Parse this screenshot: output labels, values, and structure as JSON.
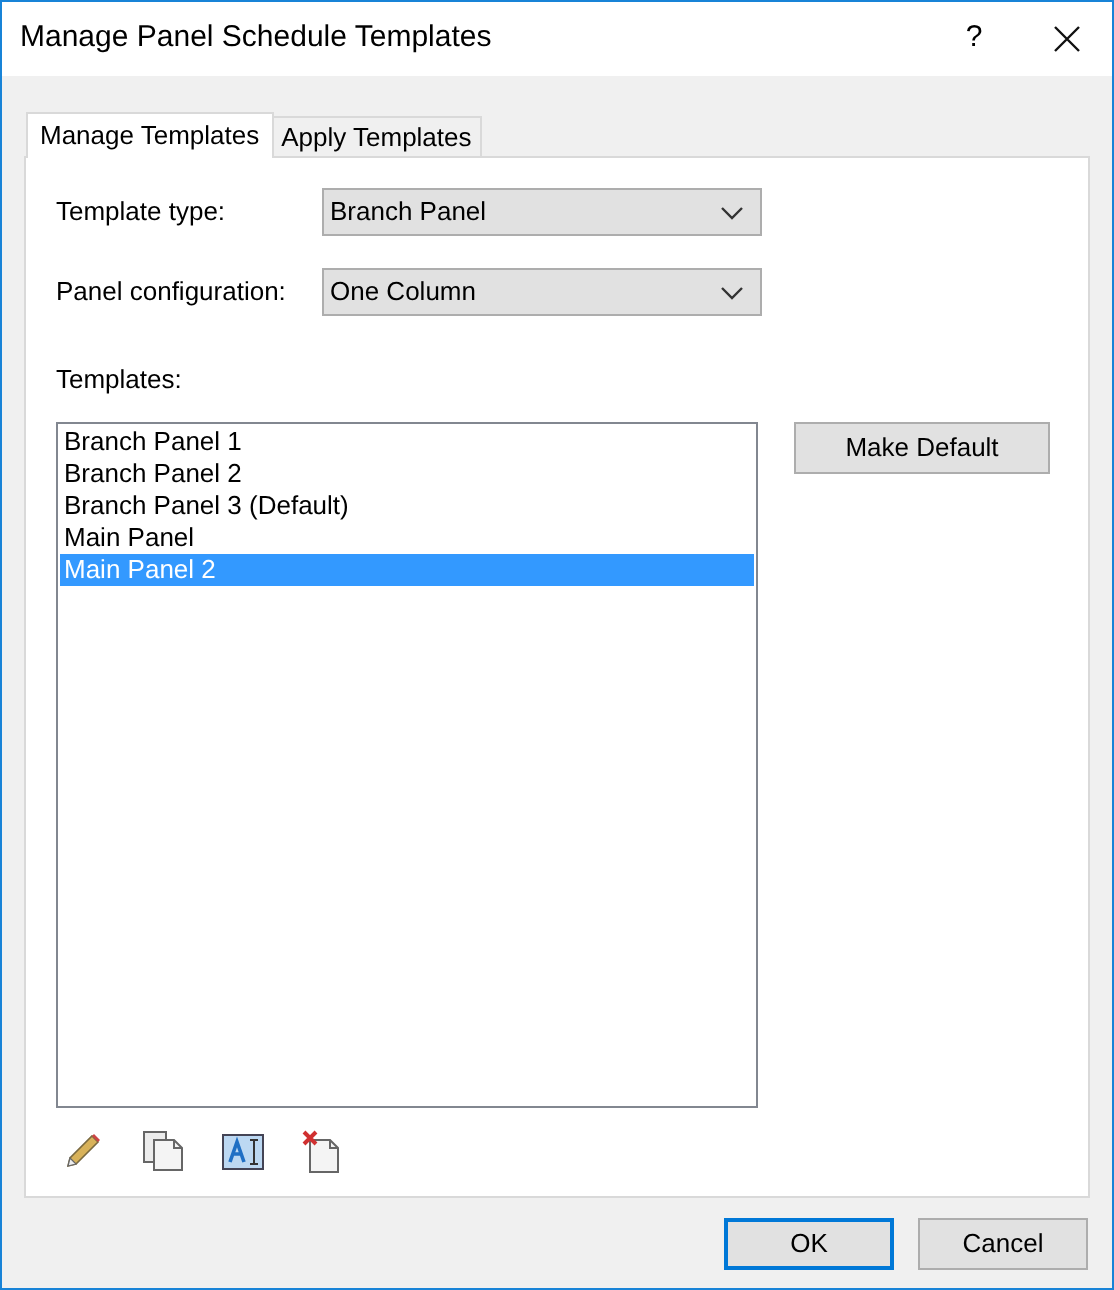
{
  "window": {
    "title": "Manage Panel Schedule Templates",
    "help": "?"
  },
  "tabs": [
    {
      "label": "Manage Templates",
      "selected": true
    },
    {
      "label": "Apply Templates",
      "selected": false
    }
  ],
  "template_type": {
    "label": "Template type:",
    "value": "Branch Panel"
  },
  "panel_configuration": {
    "label": "Panel configuration:",
    "value": "One Column"
  },
  "templates": {
    "label": "Templates:",
    "items": [
      {
        "name": "Branch Panel 1",
        "selected": false
      },
      {
        "name": "Branch Panel 2",
        "selected": false
      },
      {
        "name": "Branch Panel 3 (Default)",
        "selected": false
      },
      {
        "name": "Main Panel",
        "selected": false
      },
      {
        "name": "Main Panel 2",
        "selected": true
      }
    ]
  },
  "make_default_button": "Make Default",
  "buttons": [
    {
      "label": "OK",
      "default": true
    },
    {
      "label": "Cancel",
      "default": false
    }
  ]
}
